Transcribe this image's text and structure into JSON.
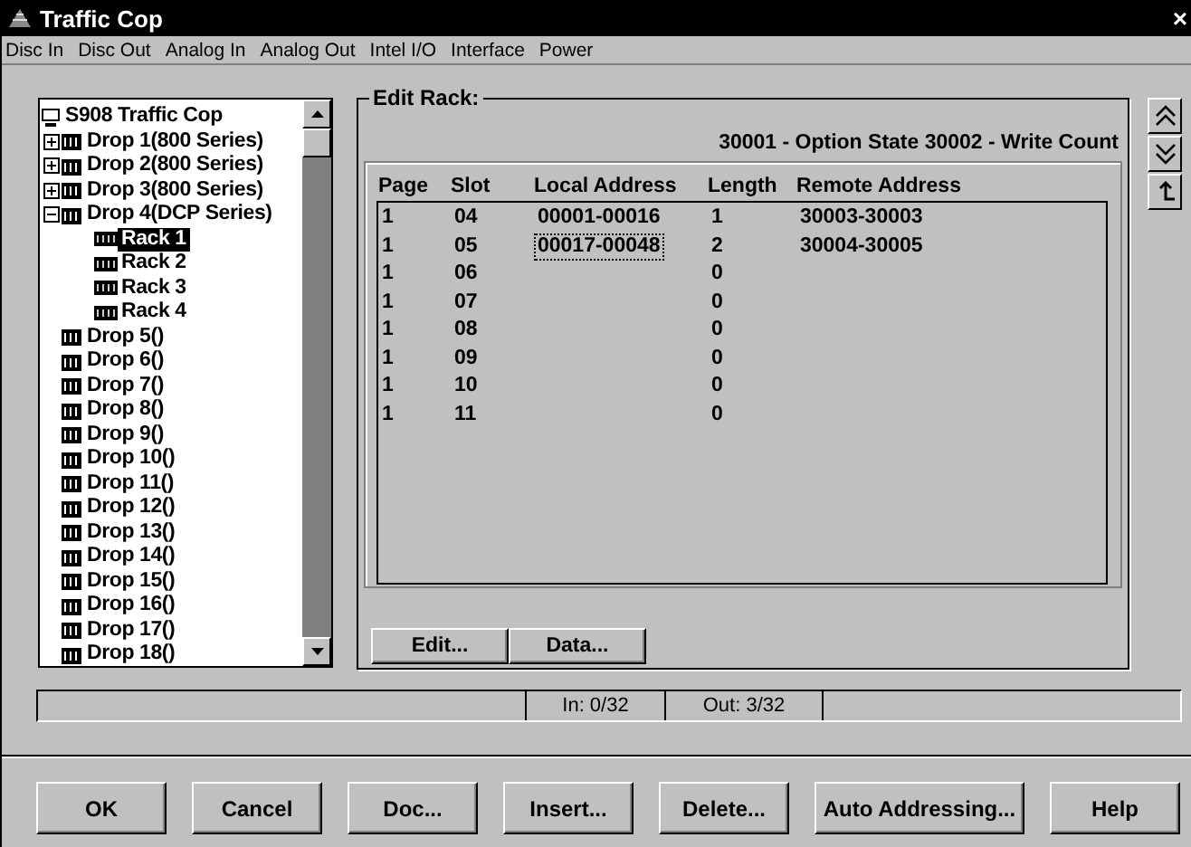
{
  "window": {
    "title": "Traffic Cop",
    "close": "×"
  },
  "menu": [
    "Disc In",
    "Disc Out",
    "Analog In",
    "Analog Out",
    "Intel I/O",
    "Interface",
    "Power"
  ],
  "tree": {
    "label": "S908 Traffic Cop",
    "kind": "root",
    "children": [
      {
        "label": "Drop 1(800 Series)",
        "kind": "drop",
        "expanded": false
      },
      {
        "label": "Drop 2(800 Series)",
        "kind": "drop",
        "expanded": false
      },
      {
        "label": "Drop 3(800 Series)",
        "kind": "drop",
        "expanded": false
      },
      {
        "label": "Drop 4(DCP Series)",
        "kind": "drop",
        "expanded": true,
        "children": [
          {
            "label": "Rack 1",
            "kind": "rack",
            "selected": true
          },
          {
            "label": "Rack 2",
            "kind": "rack",
            "selected": false
          },
          {
            "label": "Rack 3",
            "kind": "rack",
            "selected": false
          },
          {
            "label": "Rack 4",
            "kind": "rack",
            "selected": false
          }
        ]
      },
      {
        "label": "Drop 5()",
        "kind": "drop"
      },
      {
        "label": "Drop 6()",
        "kind": "drop"
      },
      {
        "label": "Drop 7()",
        "kind": "drop"
      },
      {
        "label": "Drop 8()",
        "kind": "drop"
      },
      {
        "label": "Drop 9()",
        "kind": "drop"
      },
      {
        "label": "Drop 10()",
        "kind": "drop"
      },
      {
        "label": "Drop 11()",
        "kind": "drop"
      },
      {
        "label": "Drop 12()",
        "kind": "drop"
      },
      {
        "label": "Drop 13()",
        "kind": "drop"
      },
      {
        "label": "Drop 14()",
        "kind": "drop"
      },
      {
        "label": "Drop 15()",
        "kind": "drop"
      },
      {
        "label": "Drop 16()",
        "kind": "drop"
      },
      {
        "label": "Drop 17()",
        "kind": "drop"
      },
      {
        "label": "Drop 18()",
        "kind": "drop"
      }
    ]
  },
  "edit_rack": {
    "title": "Edit Rack:",
    "legend": "30001 - Option State  30002 - Write Count",
    "columns": [
      "Page",
      "Slot",
      "Local Address",
      "Length",
      "Remote Address"
    ],
    "rows": [
      {
        "cells": [
          "1",
          "04",
          "00001-00016",
          "1",
          "30003-30003"
        ],
        "focused": false
      },
      {
        "cells": [
          "1",
          "05",
          "00017-00048",
          "2",
          "30004-30005"
        ],
        "focused": true
      },
      {
        "cells": [
          "1",
          "06",
          "",
          "0",
          ""
        ],
        "focused": false
      },
      {
        "cells": [
          "1",
          "07",
          "",
          "0",
          ""
        ],
        "focused": false
      },
      {
        "cells": [
          "1",
          "08",
          "",
          "0",
          ""
        ],
        "focused": false
      },
      {
        "cells": [
          "1",
          "09",
          "",
          "0",
          ""
        ],
        "focused": false
      },
      {
        "cells": [
          "1",
          "10",
          "",
          "0",
          ""
        ],
        "focused": false
      },
      {
        "cells": [
          "1",
          "11",
          "",
          "0",
          ""
        ],
        "focused": false
      }
    ],
    "buttons": [
      "Edit...",
      "Data..."
    ]
  },
  "status_bar": [
    "In: 0/32",
    "Out: 3/32"
  ],
  "buttons": [
    "OK",
    "Cancel",
    "Doc...",
    "Insert...",
    "Delete...",
    "Auto Addressing...",
    "Help"
  ]
}
